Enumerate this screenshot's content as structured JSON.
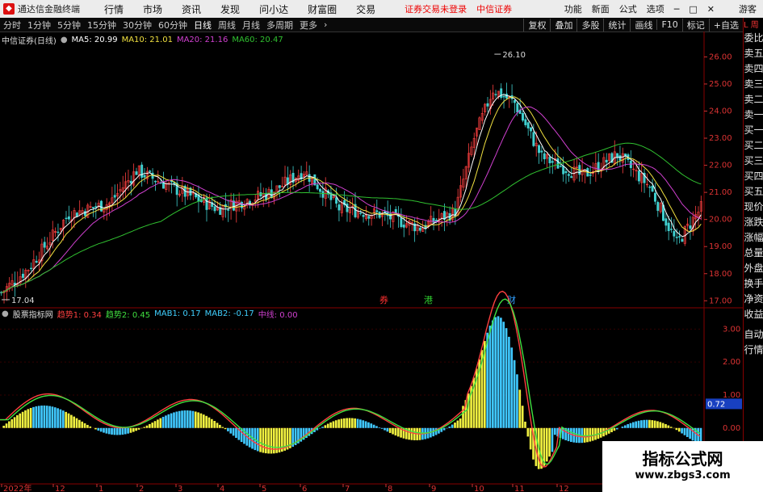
{
  "menubar": {
    "app_title": "通达信金融终端",
    "items": [
      "行情",
      "市场",
      "资讯",
      "发现",
      "问小达",
      "财富圈",
      "交易"
    ],
    "warning": "证券交易未登录",
    "broker": "中信证券",
    "right_items": [
      "功能",
      "新面",
      "公式",
      "选项"
    ],
    "guest": "游客"
  },
  "toolbar": {
    "periods": [
      "分时",
      "1分钟",
      "5分钟",
      "15分钟",
      "30分钟",
      "60分钟",
      "日线",
      "周线",
      "月线",
      "多周期",
      "更多"
    ],
    "active_period": "日线",
    "right_buttons": [
      "复权",
      "叠加",
      "多股",
      "统计",
      "画线",
      "F10",
      "标记",
      "+自选"
    ]
  },
  "main_chart": {
    "title": "中信证券(日线)",
    "ma_labels": [
      {
        "text": "MA5: 20.99",
        "color": "#ffffff"
      },
      {
        "text": "MA10: 21.01",
        "color": "#f0e040"
      },
      {
        "text": "MA20: 21.16",
        "color": "#d040d0"
      },
      {
        "text": "MA60: 20.47",
        "color": "#30c030"
      }
    ],
    "yticks": [
      "26.00",
      "25.00",
      "24.00",
      "23.00",
      "22.00",
      "21.00",
      "20.00",
      "19.00",
      "18.00",
      "17.00"
    ],
    "high_label": "26.10",
    "low_label": "17.04",
    "markers": [
      {
        "text": "券",
        "color": "#ff3030"
      },
      {
        "text": "港",
        "color": "#30d030"
      },
      {
        "text": "财",
        "color": "#30a0ff"
      }
    ]
  },
  "sub_chart": {
    "title": "股票指标网",
    "labels": [
      {
        "text": "趋势1: 0.34",
        "color": "#ff4040"
      },
      {
        "text": "趋势2: 0.45",
        "color": "#40e040"
      },
      {
        "text": "MAB1: 0.17",
        "color": "#40d0ff"
      },
      {
        "text": "MAB2: -0.17",
        "color": "#40d0ff"
      },
      {
        "text": "中线: 0.00",
        "color": "#d040d0"
      }
    ],
    "yticks": [
      "3.00",
      "2.00",
      "1.00",
      "0.00"
    ],
    "current_value": "0.72"
  },
  "x_axis": {
    "labels": [
      "2022年",
      "12",
      "1",
      "2",
      "3",
      "4",
      "5",
      "6",
      "7",
      "8",
      "9",
      "10",
      "11",
      "12"
    ]
  },
  "side_panel": {
    "corner": "L 周",
    "items": [
      "委比",
      "卖五",
      "卖四",
      "卖三",
      "卖二",
      "卖一",
      "买一",
      "买二",
      "买三",
      "买四",
      "买五",
      "现价",
      "涨跌",
      "涨幅",
      "总量",
      "外盘",
      "换手",
      "净资",
      "收益",
      "自动",
      "行情"
    ]
  },
  "watermark": {
    "line1": "指标公式网",
    "line2": "www.zbgs3.com"
  }
}
